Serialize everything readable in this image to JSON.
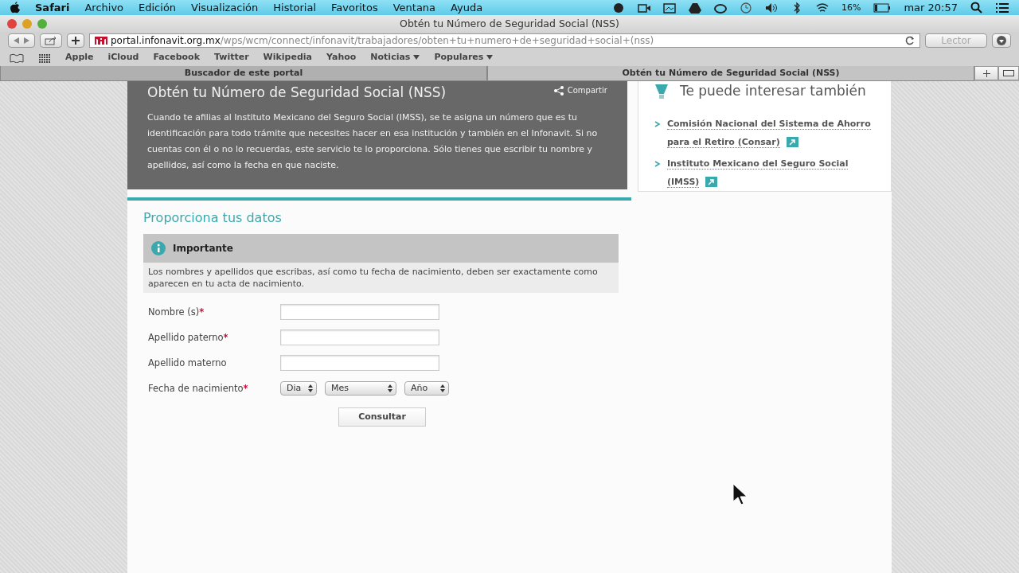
{
  "menubar": {
    "app": "Safari",
    "menus": [
      "Archivo",
      "Edición",
      "Visualización",
      "Historial",
      "Favoritos",
      "Ventana",
      "Ayuda"
    ],
    "battery": "16%",
    "clock": "mar 20:57"
  },
  "window": {
    "title": "Obtén tu Número de Seguridad Social (NSS)"
  },
  "toolbar": {
    "url_host": "portal.infonavit.org.mx",
    "url_path": "/wps/wcm/connect/infonavit/trabajadores/obten+tu+numero+de+seguridad+social+(nss)",
    "reader": "Lector"
  },
  "bookmarks": [
    {
      "label": "Apple",
      "dropdown": false
    },
    {
      "label": "iCloud",
      "dropdown": false
    },
    {
      "label": "Facebook",
      "dropdown": false
    },
    {
      "label": "Twitter",
      "dropdown": false
    },
    {
      "label": "Wikipedia",
      "dropdown": false
    },
    {
      "label": "Yahoo",
      "dropdown": false
    },
    {
      "label": "Noticias",
      "dropdown": true
    },
    {
      "label": "Populares",
      "dropdown": true
    }
  ],
  "tabs": [
    {
      "label": "Buscador de este portal",
      "selected": false
    },
    {
      "label": "Obtén tu Número de Seguridad Social (NSS)",
      "selected": true
    }
  ],
  "intro": {
    "title": "Obtén tu Número de Seguridad Social (NSS)",
    "share": "Compartir",
    "text": "Cuando te afilias al Instituto Mexicano del Seguro Social (IMSS), se te asigna un número que es tu identificación para todo trámite que necesites hacer en esa institución y también en el Infonavit. Si no cuentas con él o no lo recuerdas, este servicio te lo proporciona. Sólo tienes que escribir tu nombre y apellidos, así como la fecha en que naciste."
  },
  "related": {
    "title": "Te puede interesar también",
    "links": [
      "Comisión Nacional del Sistema de Ahorro para el Retiro (Consar)",
      "Instituto Mexicano del Seguro Social (IMSS)"
    ]
  },
  "form": {
    "title": "Proporciona tus datos",
    "notice": {
      "title": "Importante",
      "text": "Los nombres y apellidos que escribas, así como tu fecha de nacimiento, deben ser exactamente como aparecen en tu acta de nacimiento."
    },
    "fields": [
      {
        "kind": "text",
        "label": "Nombre (s)",
        "required": true
      },
      {
        "kind": "text",
        "label": "Apellido paterno",
        "required": true
      },
      {
        "kind": "text",
        "label": "Apellido materno",
        "required": false
      },
      {
        "kind": "date",
        "label": "Fecha de nacimiento",
        "required": true,
        "selects": [
          "Dia",
          "Mes",
          "Año"
        ]
      }
    ],
    "submit": "Consultar",
    "required_mark": "*"
  }
}
